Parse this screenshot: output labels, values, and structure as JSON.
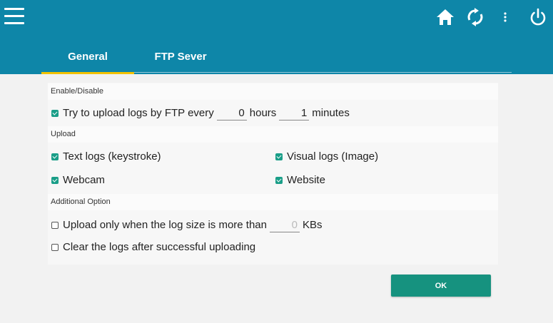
{
  "header": {
    "menu_icon": "hamburger-menu-icon",
    "actions": [
      {
        "name": "home-icon"
      },
      {
        "name": "refresh-icon"
      },
      {
        "name": "more-vert-icon"
      },
      {
        "name": "power-icon"
      }
    ],
    "tabs": [
      {
        "label": "General",
        "active": true
      },
      {
        "label": "FTP Sever",
        "active": false
      }
    ],
    "colors": {
      "bar": "#0e86a8",
      "active_tab_underline": "#f2c200",
      "checkbox": "#1a9e88",
      "button": "#16927f"
    }
  },
  "enable_section": {
    "title": "Enable/Disable",
    "upload_checked": true,
    "upload_label": "Try to upload logs by FTP every",
    "hours_value": "0",
    "hours_unit": "hours",
    "minutes_value": "1",
    "minutes_unit": "minutes"
  },
  "upload_section": {
    "title": "Upload",
    "options": [
      {
        "label": "Text logs (keystroke)",
        "checked": true
      },
      {
        "label": "Visual logs (Image)",
        "checked": true
      },
      {
        "label": "Webcam",
        "checked": true
      },
      {
        "label": "Website",
        "checked": true
      }
    ]
  },
  "additional_section": {
    "title": "Additional Option",
    "size_option_label": "Upload only when the log size is more than",
    "size_option_checked": false,
    "size_value": "0",
    "size_unit": "KBs",
    "clear_option_label": "Clear the logs after successful uploading",
    "clear_option_checked": false
  },
  "ok_label": "OK"
}
